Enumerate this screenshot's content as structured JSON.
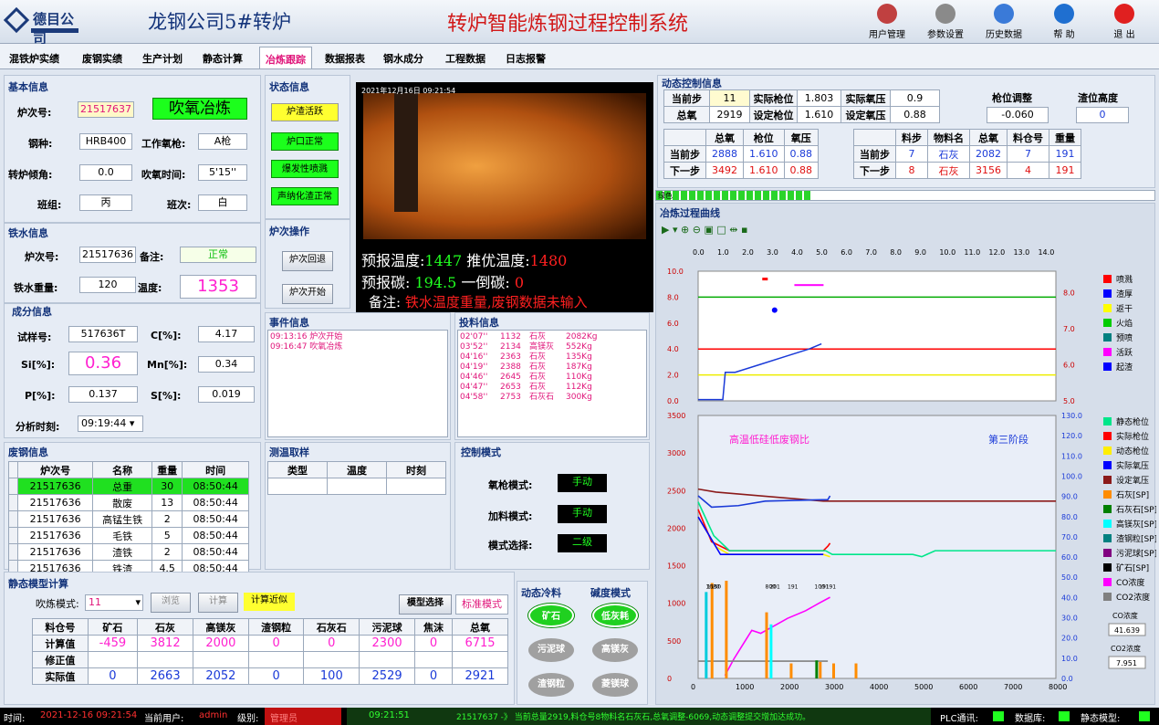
{
  "header": {
    "logo_text": "德目公司",
    "plant_title": "龙钢公司5#转炉",
    "system_title": "转炉智能炼钢过程控制系统",
    "tools": [
      {
        "label": "用户管理",
        "icon": "users-icon"
      },
      {
        "label": "参数设置",
        "icon": "settings-icon"
      },
      {
        "label": "历史数据",
        "icon": "database-icon"
      },
      {
        "label": "帮 助",
        "icon": "help-icon"
      },
      {
        "label": "退 出",
        "icon": "exit-icon"
      }
    ]
  },
  "menu": [
    "混铁炉实绩",
    "废钢实绩",
    "生产计划",
    "静态计算",
    "冶炼跟踪",
    "数据报表",
    "钢水成分",
    "工程数据",
    "日志报警"
  ],
  "basic": {
    "title": "基本信息",
    "heat_label": "炉次号:",
    "heat": "21517637",
    "state": "吹氧冶炼",
    "grade_label": "钢种:",
    "grade": "HRB400",
    "lance_label": "工作氧枪:",
    "lance": "A枪",
    "tilt_label": "转炉倾角:",
    "tilt": "0.0",
    "blow_label": "吹氧时间:",
    "blow": "5'15''",
    "team_label": "班组:",
    "team": "丙",
    "shift_label": "班次:",
    "shift": "白"
  },
  "status": {
    "title": "状态信息",
    "items": [
      "炉渣活跃",
      "炉口正常",
      "爆发性喷溅",
      "声纳化渣正常"
    ]
  },
  "furnace": {
    "timestamp": "2021年12月16日 09:21:54",
    "temp_label": "预报温度:",
    "temp": "1447",
    "opt_label": "推优温度:",
    "opt": "1480",
    "carbon_label": "预报碳:",
    "carbon": "194.5",
    "c2_label": "一倒碳:",
    "c2": "0",
    "note_label": "备注:",
    "note": "铁水温度重量,废钢数据未输入"
  },
  "iron": {
    "title": "铁水信息",
    "heat_label": "炉次号:",
    "heat": "21517636",
    "note_label": "备注:",
    "note": "正常",
    "weight_label": "铁水重量:",
    "weight": "120",
    "temp_label": "温度:",
    "temp": "1353"
  },
  "ops": {
    "title": "炉次操作",
    "back": "炉次回退",
    "start": "炉次开始"
  },
  "comp": {
    "title": "成分信息",
    "sample_label": "试样号:",
    "sample": "517636T",
    "c_label": "C[%]:",
    "c": "4.17",
    "si_label": "Si[%]:",
    "si": "0.36",
    "mn_label": "Mn[%]:",
    "mn": "0.34",
    "p_label": "P[%]:",
    "p": "0.137",
    "s_label": "S[%]:",
    "s": "0.019",
    "time_label": "分析时刻:",
    "time": "09:19:44"
  },
  "events": {
    "title": "事件信息",
    "rows": [
      "09:13:16 炉次开始",
      "09:16:47 吹氧冶炼"
    ]
  },
  "feed": {
    "title": "投料信息",
    "rows": [
      [
        "02'07''",
        "1132",
        "石灰",
        "2082Kg"
      ],
      [
        "03'52''",
        "2134",
        "高镁灰",
        "552Kg"
      ],
      [
        "04'16''",
        "2363",
        "石灰",
        "135Kg"
      ],
      [
        "04'19''",
        "2388",
        "石灰",
        "187Kg"
      ],
      [
        "04'46''",
        "2645",
        "石灰",
        "110Kg"
      ],
      [
        "04'47''",
        "2653",
        "石灰",
        "112Kg"
      ],
      [
        "04'58''",
        "2753",
        "石灰石",
        "300Kg"
      ]
    ]
  },
  "scrap": {
    "title": "废钢信息",
    "headers": [
      "炉次号",
      "名称",
      "重量",
      "时间"
    ],
    "rows": [
      [
        "21517636",
        "总重",
        "30",
        "08:50:44"
      ],
      [
        "21517636",
        "散废",
        "13",
        "08:50:44"
      ],
      [
        "21517636",
        "高锰生铁",
        "2",
        "08:50:44"
      ],
      [
        "21517636",
        "毛铁",
        "5",
        "08:50:44"
      ],
      [
        "21517636",
        "渣铁",
        "2",
        "08:50:44"
      ],
      [
        "21517636",
        "铁渣",
        "4.5",
        "08:50:44"
      ]
    ]
  },
  "temp_sample": {
    "title": "测温取样",
    "headers": [
      "类型",
      "温度",
      "时刻"
    ]
  },
  "control": {
    "title": "控制模式",
    "lance_label": "氧枪模式:",
    "lance": "手动",
    "feed_label": "加料模式:",
    "feed": "手动",
    "mode_label": "模式选择:",
    "mode": "二级"
  },
  "static": {
    "title": "静态模型计算",
    "blow_label": "吹炼模式:",
    "blow_val": "11",
    "preview": "浏览",
    "calc": "计算",
    "approx": "计算近似",
    "model_sel": "模型选择",
    "model_std": "标准模式",
    "headers": [
      "料仓号",
      "矿石",
      "石灰",
      "高镁灰",
      "渣钢粒",
      "石灰石",
      "污泥球",
      "焦沫",
      "总氧"
    ],
    "rows": [
      [
        "计算值",
        "-459",
        "3812",
        "2000",
        "0",
        "0",
        "2300",
        "0",
        "6715"
      ],
      [
        "修正值",
        "",
        "",
        "",
        "",
        "",
        "",
        "",
        ""
      ],
      [
        "实际值",
        "0",
        "2663",
        "2052",
        "0",
        "100",
        "2529",
        "0",
        "2921"
      ]
    ]
  },
  "dyn_mat": {
    "title": "动态冷料",
    "basic_title": "碱度模式",
    "items": [
      "矿石",
      "低灰耗",
      "污泥球",
      "高镁灰",
      "渣钢粒",
      "菱镁球"
    ]
  },
  "dyn": {
    "title": "动态控制信息",
    "cur_step_label": "当前步",
    "cur_step": "11",
    "act_lance_label": "实际枪位",
    "act_lance": "1.803",
    "act_press_label": "实际氧压",
    "act_press": "0.9",
    "total_o2_label": "总氧",
    "total_o2": "2919",
    "set_lance_label": "设定枪位",
    "set_lance": "1.610",
    "set_press_label": "设定氧压",
    "set_press": "0.88",
    "adj_label": "枪位调整",
    "adj": "-0.060",
    "slag_label": "渣位高度",
    "slag": "0",
    "t1_headers": [
      "",
      "总氧",
      "枪位",
      "氧压"
    ],
    "t1_rows": [
      [
        "当前步",
        "2888",
        "1.610",
        "0.88"
      ],
      [
        "下一步",
        "3492",
        "1.610",
        "0.88"
      ]
    ],
    "t2_headers": [
      "",
      "料步",
      "物料名",
      "总氧",
      "料仓号",
      "重量"
    ],
    "t2_rows": [
      [
        "当前步",
        "7",
        "石灰",
        "2082",
        "7",
        "191"
      ],
      [
        "下一步",
        "8",
        "石灰",
        "3156",
        "4",
        "191"
      ]
    ]
  },
  "progress": {
    "label": "绿色"
  },
  "chart_data": {
    "type": "line",
    "title": "冶炼过程曲线",
    "top": {
      "x_ticks": [
        "0.0",
        "1.0",
        "2.0",
        "3.0",
        "4.0",
        "5.0",
        "6.0",
        "7.0",
        "8.0",
        "9.0",
        "10.0",
        "11.0",
        "12.0",
        "13.0",
        "14.0"
      ],
      "y_left": [
        "0.0",
        "2.0",
        "4.0",
        "6.0",
        "8.0",
        "10.0"
      ],
      "y_right": [
        "5.0",
        "6.0",
        "7.0",
        "8.0"
      ],
      "series": [
        {
          "name": "喷溅",
          "color": "#ff0000"
        },
        {
          "name": "渣厚",
          "color": "#0000ff"
        },
        {
          "name": "返干",
          "color": "#ffff00"
        },
        {
          "name": "火焰",
          "color": "#00cc00"
        },
        {
          "name": "预喷",
          "color": "#008080"
        },
        {
          "name": "活跃",
          "color": "#ff00ff"
        },
        {
          "name": "起渣",
          "color": "#0000ff"
        }
      ],
      "lance_curve": [
        [
          0,
          0.1
        ],
        [
          1.0,
          0.1
        ],
        [
          1.1,
          2.2
        ],
        [
          1.5,
          2.2
        ],
        [
          2.5,
          2.8
        ],
        [
          3.5,
          3.4
        ],
        [
          4.5,
          4.0
        ],
        [
          5.0,
          4.4
        ]
      ]
    },
    "bottom": {
      "annot1": "高温低硅低废钢比",
      "annot2": "第三阶段",
      "x_ticks": [
        "0",
        "1000",
        "2000",
        "3000",
        "4000",
        "5000",
        "6000",
        "7000",
        "8000"
      ],
      "y_left": [
        "0",
        "500",
        "1000",
        "1500",
        "2000",
        "2500",
        "3000",
        "3500"
      ],
      "y_right": [
        "0.0",
        "10.0",
        "20.0",
        "30.0",
        "40.0",
        "50.0",
        "60.0",
        "70.0",
        "80.0",
        "90.0",
        "100.0",
        "110.0",
        "120.0",
        "130.0"
      ],
      "series": [
        {
          "name": "静态枪位",
          "color": "#00e68a"
        },
        {
          "name": "实际枪位",
          "color": "#ff0000"
        },
        {
          "name": "动态枪位",
          "color": "#ffee00"
        },
        {
          "name": "实际氧压",
          "color": "#0000ff"
        },
        {
          "name": "设定氧压",
          "color": "#8b1a1a"
        },
        {
          "name": "石灰[SP]",
          "color": "#ff8c00"
        },
        {
          "name": "石灰石[SP]",
          "color": "#008000"
        },
        {
          "name": "高镁灰[SP]",
          "color": "#00ffff"
        },
        {
          "name": "渣钢粒[SP]",
          "color": "#008080"
        },
        {
          "name": "污泥球[SP]",
          "color": "#800080"
        },
        {
          "name": "矿石[SP]",
          "color": "#000000"
        },
        {
          "name": "CO浓度",
          "color": "#ff00ff"
        },
        {
          "name": "CO2浓度",
          "color": "#808080"
        }
      ],
      "co_label": "CO浓度",
      "co": "41.639",
      "co2_label": "CO2浓度",
      "co2": "7.951",
      "bar_labels": [
        {
          "x": 200,
          "t": "1150"
        },
        {
          "x": 1500,
          "t": "800"
        },
        {
          "x": 1600,
          "t": "201"
        },
        {
          "x": 2000,
          "t": "191"
        },
        {
          "x": 2700,
          "t": "191"
        },
        {
          "x": 2850,
          "t": "191"
        },
        {
          "x": 2600,
          "t": "100"
        },
        {
          "x": 170,
          "t": "1680"
        }
      ]
    }
  },
  "statusbar": {
    "time_label": "时间:",
    "time": "2021-12-16 09:21:54",
    "user_label": "当前用户:",
    "user": "admin",
    "level_label": "级别:",
    "level": "管理员",
    "clock": "09:21:51",
    "msg": "21517637 -》 当前总量2919,料仓号8物料名石灰石,总氧调整-6069,动态调整提交增加达成功。",
    "plc": "PLC通讯:",
    "db": "数据库:",
    "model": "静态模型:"
  }
}
